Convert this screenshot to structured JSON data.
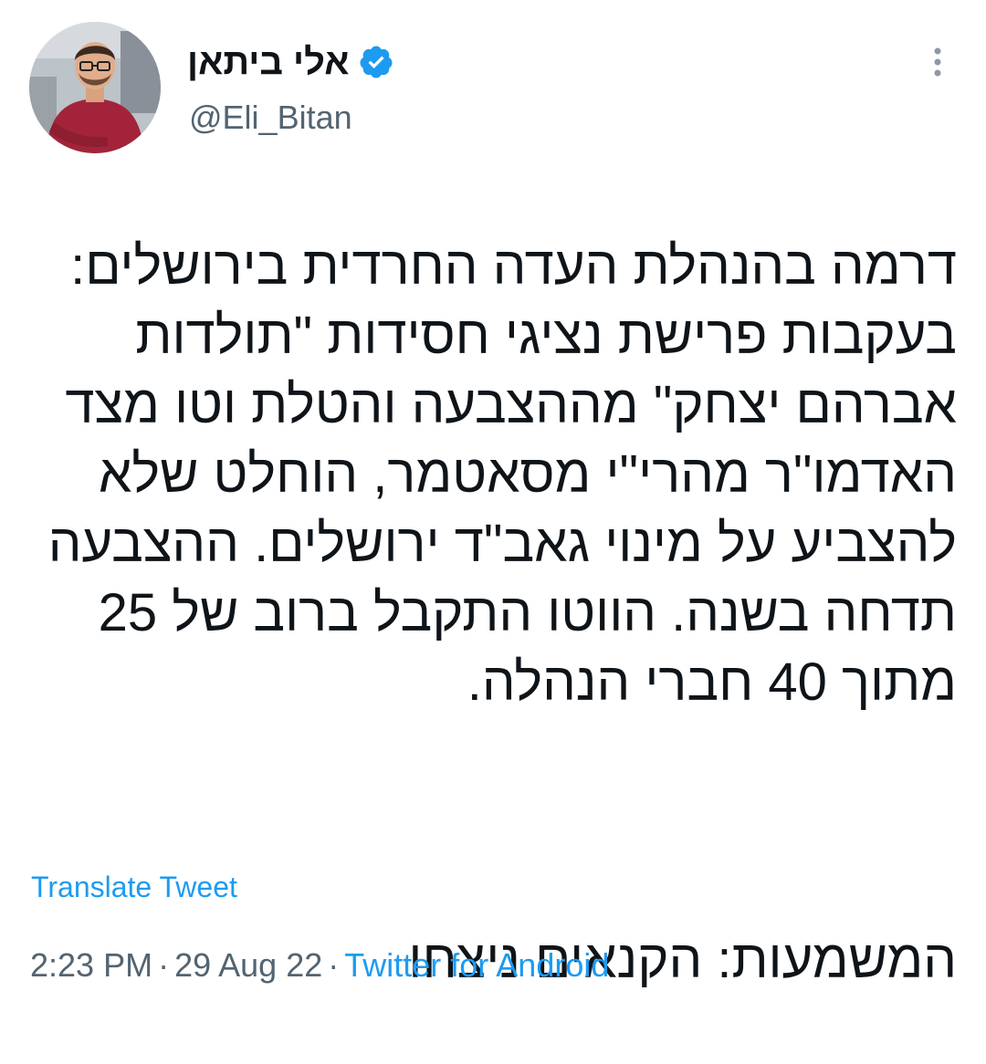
{
  "user": {
    "display_name": "אלי ביתאן",
    "handle": "@Eli_Bitan",
    "verified_icon": "verified-badge-icon",
    "accent_color": "#1d9bf0"
  },
  "header": {
    "more_icon": "more-vertical-icon"
  },
  "tweet": {
    "paragraph_1": "דרמה בהנהלת העדה החרדית בירושלים: בעקבות פרישת נציגי חסידות \"תולדות אברהם יצחק\" מההצבעה והטלת וטו מצד האדמו\"ר מהרי\"י מסאטמר, הוחלט שלא להצביע על מינוי גאב\"ד ירושלים. ההצבעה תדחה בשנה. הווטו התקבל ברוב של 25 מתוך 40 חברי הנהלה.",
    "paragraph_2": "המשמעות: הקנאים ניצחו"
  },
  "actions": {
    "translate_label": "Translate Tweet"
  },
  "meta": {
    "time": "2:23 PM",
    "separator": "·",
    "date": "29 Aug 22",
    "source": "Twitter for Android"
  },
  "colors": {
    "text": "#0f1419",
    "secondary": "#536471",
    "link": "#1d9bf0"
  }
}
